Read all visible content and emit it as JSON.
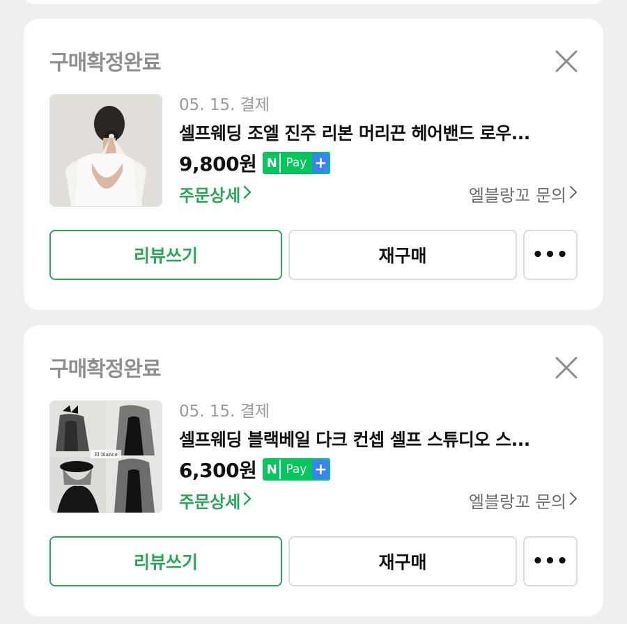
{
  "orders": [
    {
      "status": "구매확정완료",
      "date": "05. 15. 결제",
      "title": "셀프웨딩 조엘 진주 리본 머리끈 헤어밴드 로우...",
      "price": "9,800원",
      "pay_badge": {
        "n": "N",
        "pay": "Pay",
        "plus": "+"
      },
      "order_detail": "주문상세",
      "inquiry": "엘블랑꼬 문의",
      "buttons": {
        "review": "리뷰쓰기",
        "rebuy": "재구매",
        "more": "•••"
      }
    },
    {
      "status": "구매확정완료",
      "date": "05. 15. 결제",
      "title": "셀프웨딩 블랙베일 다크 컨셉 셀프 스튜디오 스...",
      "price": "6,300원",
      "pay_badge": {
        "n": "N",
        "pay": "Pay",
        "plus": "+"
      },
      "order_detail": "주문상세",
      "inquiry": "엘블랑꼬 문의",
      "buttons": {
        "review": "리뷰쓰기",
        "rebuy": "재구매",
        "more": "•••"
      },
      "thumb_caption": "El blanco"
    }
  ],
  "colors": {
    "accent_green": "#2aa55a",
    "npay_green": "#03c75a",
    "npay_blue": "#3a83f7",
    "background": "#eeeff1"
  },
  "icons": [
    "close-icon",
    "chevron-right-icon"
  ]
}
